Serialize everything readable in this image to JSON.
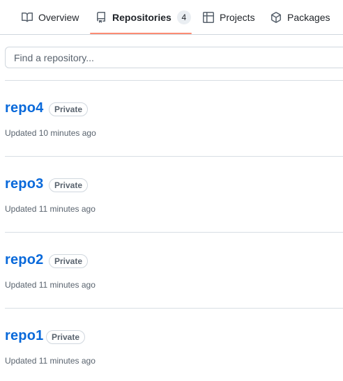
{
  "nav": {
    "tabs": [
      {
        "label": "Overview",
        "icon": "book-icon"
      },
      {
        "label": "Repositories",
        "icon": "repo-icon",
        "counter": "4",
        "selected": true
      },
      {
        "label": "Projects",
        "icon": "table-icon"
      },
      {
        "label": "Packages",
        "icon": "package-icon"
      }
    ]
  },
  "search": {
    "placeholder": "Find a repository...",
    "value": ""
  },
  "repositories": [
    {
      "name": "repo4",
      "visibility": "Private",
      "updated": "Updated 10 minutes ago"
    },
    {
      "name": "repo3",
      "visibility": "Private",
      "updated": "Updated 11 minutes ago"
    },
    {
      "name": "repo2",
      "visibility": "Private",
      "updated": "Updated 11 minutes ago"
    },
    {
      "name": "repo1",
      "visibility": "Private",
      "updated": "Updated 11 minutes ago"
    }
  ],
  "colors": {
    "link": "#0969da",
    "selected_underline": "#fd8c73",
    "muted_text": "#59636e",
    "border": "#d0d7de"
  }
}
